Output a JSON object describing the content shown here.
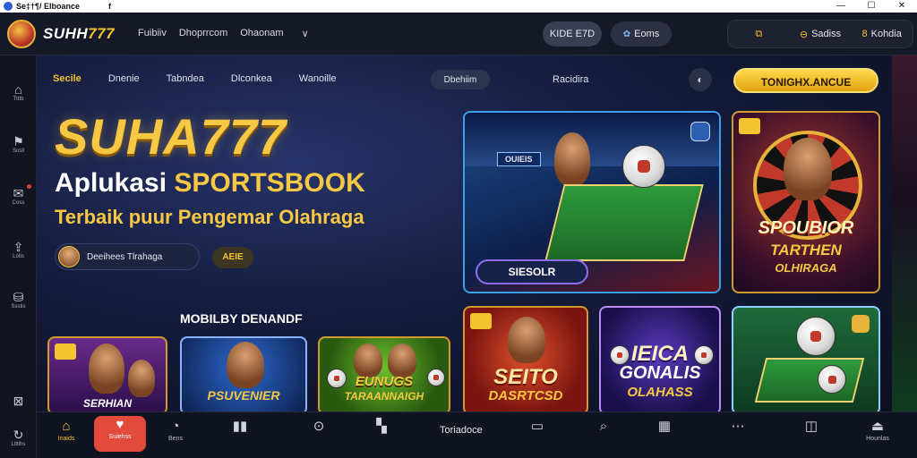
{
  "window": {
    "title": "Se‡†¶/ Elboance",
    "social": "f",
    "controls": [
      "—",
      "☐",
      "✕"
    ]
  },
  "header": {
    "logo_prefix": "SUHH",
    "logo_number": "777",
    "nav": [
      "Fuibiiv",
      "Dhoprrcom",
      "Ohaonam"
    ],
    "nav_chevron": "∨",
    "pill1": "KIDE E7D",
    "pill2": "Eoms",
    "right_group": [
      {
        "icon": "⧉",
        "label": ""
      },
      {
        "icon": "⊖",
        "label": "Sadiss"
      },
      {
        "icon": "8",
        "label": "Kohdia"
      }
    ]
  },
  "sidebar": {
    "items": [
      {
        "icon": "⌂",
        "label": "Ttttb"
      },
      {
        "icon": "⚑",
        "label": "Sosll"
      },
      {
        "icon": "✉",
        "label": "Coss"
      },
      {
        "icon": "⇪",
        "label": "Lotis"
      },
      {
        "icon": "⛁",
        "label": "Ssstis"
      },
      {
        "icon": "⊠",
        "label": ""
      },
      {
        "icon": "↻",
        "label": "Llttlhs"
      }
    ]
  },
  "main": {
    "subnav": [
      "Secile",
      "Dnenie",
      "Tabndea",
      "Dlconkea",
      "Wanoille"
    ],
    "subpill": "Dbehiim",
    "sub_right": "Racidira",
    "circle_icon": "◐",
    "cta": "TONIGHX.ANCUE",
    "hero_title": "SUHA777",
    "hero_sub_plain": "Aplukasi ",
    "hero_sub_highlight": "SPORTSBOOK",
    "hero_tagline": "Terbaik puur Pengemar Olahraga",
    "user_pill": "Deeihees Tlrahaga",
    "tag_pill": "AEIE",
    "section_title": "MOBILBY DENANDF"
  },
  "cards": {
    "a": {
      "badge": "OUIEIS",
      "button": "SIESOLR"
    },
    "b": {
      "line1": "SPOUBIOR",
      "line2": "TARTHEN",
      "line3": "OLHIRAGA"
    },
    "c": {
      "caption": "SERHIAN"
    },
    "d": {
      "caption": "PSUVENIER"
    },
    "e": {
      "line1": "EUNUGS",
      "line2": "TARAANNAIGH"
    },
    "f": {
      "line1": "SEITO",
      "line2": "DASRTCSD"
    },
    "g": {
      "line1": "IEICA",
      "line2": "GONALIS",
      "line3": "OLAHASS"
    },
    "h": {}
  },
  "bottombar": {
    "items": [
      {
        "icon": "⌂",
        "label": "Inaids"
      },
      {
        "icon": "♥",
        "label": "Suiehss"
      },
      {
        "icon": "◔",
        "label": "Bens"
      },
      {
        "icon": "▮▮",
        "label": ""
      },
      {
        "icon": "⊙",
        "label": ""
      },
      {
        "icon": "▚",
        "label": ""
      },
      {
        "icon": "▭",
        "label": ""
      },
      {
        "icon": "⌕",
        "label": ""
      },
      {
        "icon": "▦",
        "label": ""
      },
      {
        "icon": "⋯",
        "label": ""
      },
      {
        "icon": "◫",
        "label": ""
      },
      {
        "icon": "⏏",
        "label": "Hounlas"
      }
    ],
    "center_text": "Toriadoce"
  },
  "colors": {
    "accent_gold": "#f4c430",
    "background": "#0c0f1c",
    "hot_red": "#e24a3a"
  }
}
